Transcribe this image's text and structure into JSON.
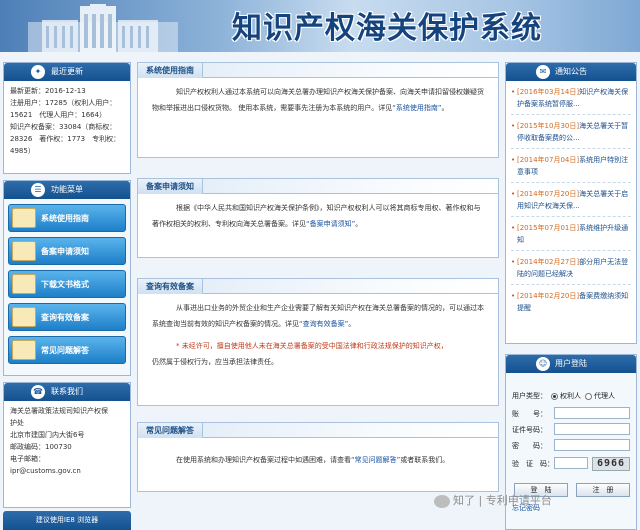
{
  "header": {
    "title": "知识产权海关保护系统"
  },
  "stats": {
    "heading": "最近更新",
    "lines": [
      "最新更新：2016-12-13",
      "注册用户：17285（权利人用户：",
      "15621　代理人用户：1664）",
      "知识产权备案：33084（商标权：",
      "28326　著作权：1773　专利权：",
      "4985）"
    ]
  },
  "menu": {
    "heading": "功能菜单",
    "items": [
      "系统使用指南",
      "备案申请须知",
      "下载文书格式",
      "查询有效备案",
      "常见问题解答"
    ]
  },
  "contact": {
    "heading": "联系我们",
    "lines": [
      "海关总署政策法规司知识产权保",
      "护处",
      "北京市建国门内大街6号",
      "邮政编码：100730",
      "电子邮箱：",
      "ipr@customs.gov.cn"
    ]
  },
  "ie_button": "建议使用IE8 浏览器",
  "sections": {
    "guide": {
      "title": "系统使用指南",
      "text": "知识产权权利人通过本系统可以向海关总署办理知识产权海关保护备案、向海关申请扣留侵权嫌疑货物和举报进出口侵权货物。 使用本系统，需要事先注册为本系统的用户。详见",
      "link": "“系统使用指南”",
      "tail": "。"
    },
    "apply": {
      "title": "备案申请须知",
      "text": "根据《中华人民共和国知识产权海关保护条例》，知识产权权利人可以将其商标专用权、著作权和与著作权相关的权利、专利权向海关总署备案。详见",
      "link": "“备案申请须知”",
      "tail": "。"
    },
    "query": {
      "title": "查询有效备案",
      "text": "从事进出口业务的外贸企业和生产企业需要了解有关知识产权在海关总署备案的情况的，可以通过本系统查询当前有效的知识产权备案的情况。详见",
      "link": "“查询有效备案”",
      "tail": "。",
      "warn": "* 未经许可，擅自使用他人未在海关总署备案的受中国法律和行政法规保护的知识产权，",
      "warn2": "仍然属于侵权行为，应当承担法律责任。"
    },
    "faq": {
      "title": "常见问题解答",
      "text": "在使用系统和办理知识产权备案过程中如遇困难，请查看",
      "link": "“常见问题解答”",
      "tail": "或者联系我们。"
    }
  },
  "notice": {
    "heading": "通知公告",
    "items": [
      {
        "date": "[2016年03月14日]",
        "text": "知识产权海关保护备案系统暂停服..."
      },
      {
        "date": "[2015年10月30日]",
        "text": "海关总署关于暂停收取备案费的公..."
      },
      {
        "date": "[2014年07月04日]",
        "text": "系统用户特别注意事项"
      },
      {
        "date": "[2014年07月20日]",
        "text": "海关总署关于启用知识产权海关保..."
      },
      {
        "date": "[2015年07月01日]",
        "text": "系统维护升级通知"
      },
      {
        "date": "[2014年02月27日]",
        "text": "部分用户无法登陆的问题已经解决"
      },
      {
        "date": "[2014年02月20日]",
        "text": "备案费缴纳须知提醒"
      }
    ]
  },
  "login": {
    "heading": "用户登陆",
    "user_type_label": "用户类型：",
    "opt_owner": "权利人",
    "opt_agent": "代理人",
    "account_label": "账　　号：",
    "id_label": "证件号码：",
    "password_label": "密　　码：",
    "captcha_label": "验　证　码：",
    "captcha_value": "6966",
    "login_button": "登　陆",
    "register_button": "注　册",
    "forgot_link": "忘记密码"
  },
  "watermark": "知了 | 专利申请平台"
}
